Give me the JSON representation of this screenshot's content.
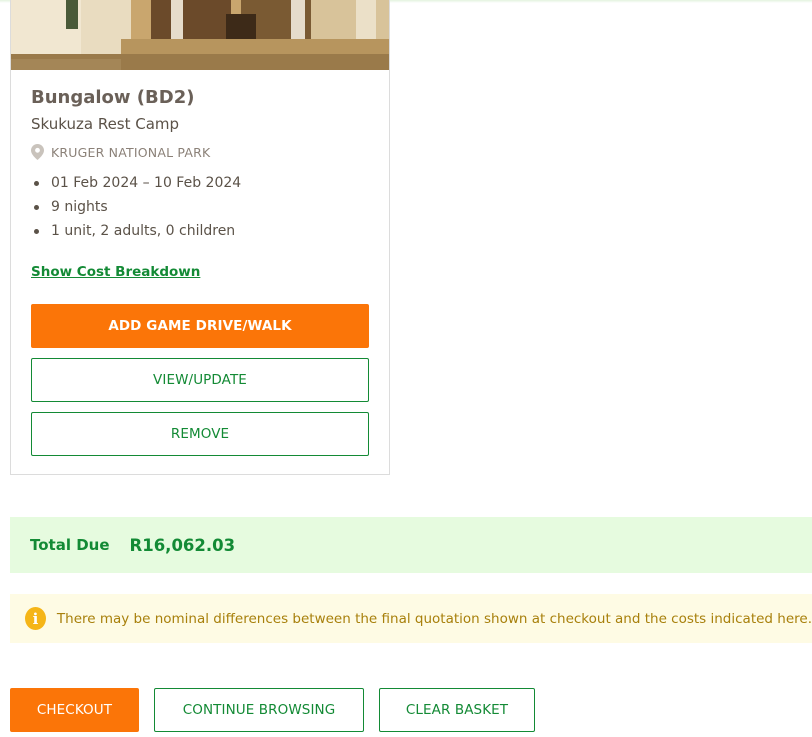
{
  "booking": {
    "title": "Bungalow (BD2)",
    "camp": "Skukuza Rest Camp",
    "park": "KRUGER NATIONAL PARK",
    "details": [
      "01 Feb 2024 – 10 Feb 2024",
      "9 nights",
      "1 unit, 2 adults, 0 children"
    ],
    "cost_link": "Show Cost Breakdown",
    "add_button": "ADD GAME DRIVE/WALK",
    "view_button": "VIEW/UPDATE",
    "remove_button": "REMOVE"
  },
  "total": {
    "label": "Total Due",
    "value": "R16,062.03"
  },
  "notice": {
    "icon": "info-icon",
    "text": "There may be nominal differences between the final quotation shown at checkout and the costs indicated here."
  },
  "actions": {
    "checkout": "CHECKOUT",
    "continue": "CONTINUE BROWSING",
    "clear": "CLEAR BASKET"
  },
  "colors": {
    "accent_orange": "#fb7508",
    "accent_green": "#138a35",
    "total_bg": "#e6fbdf",
    "notice_bg": "#fefbe4",
    "notice_text": "#a8800c"
  }
}
